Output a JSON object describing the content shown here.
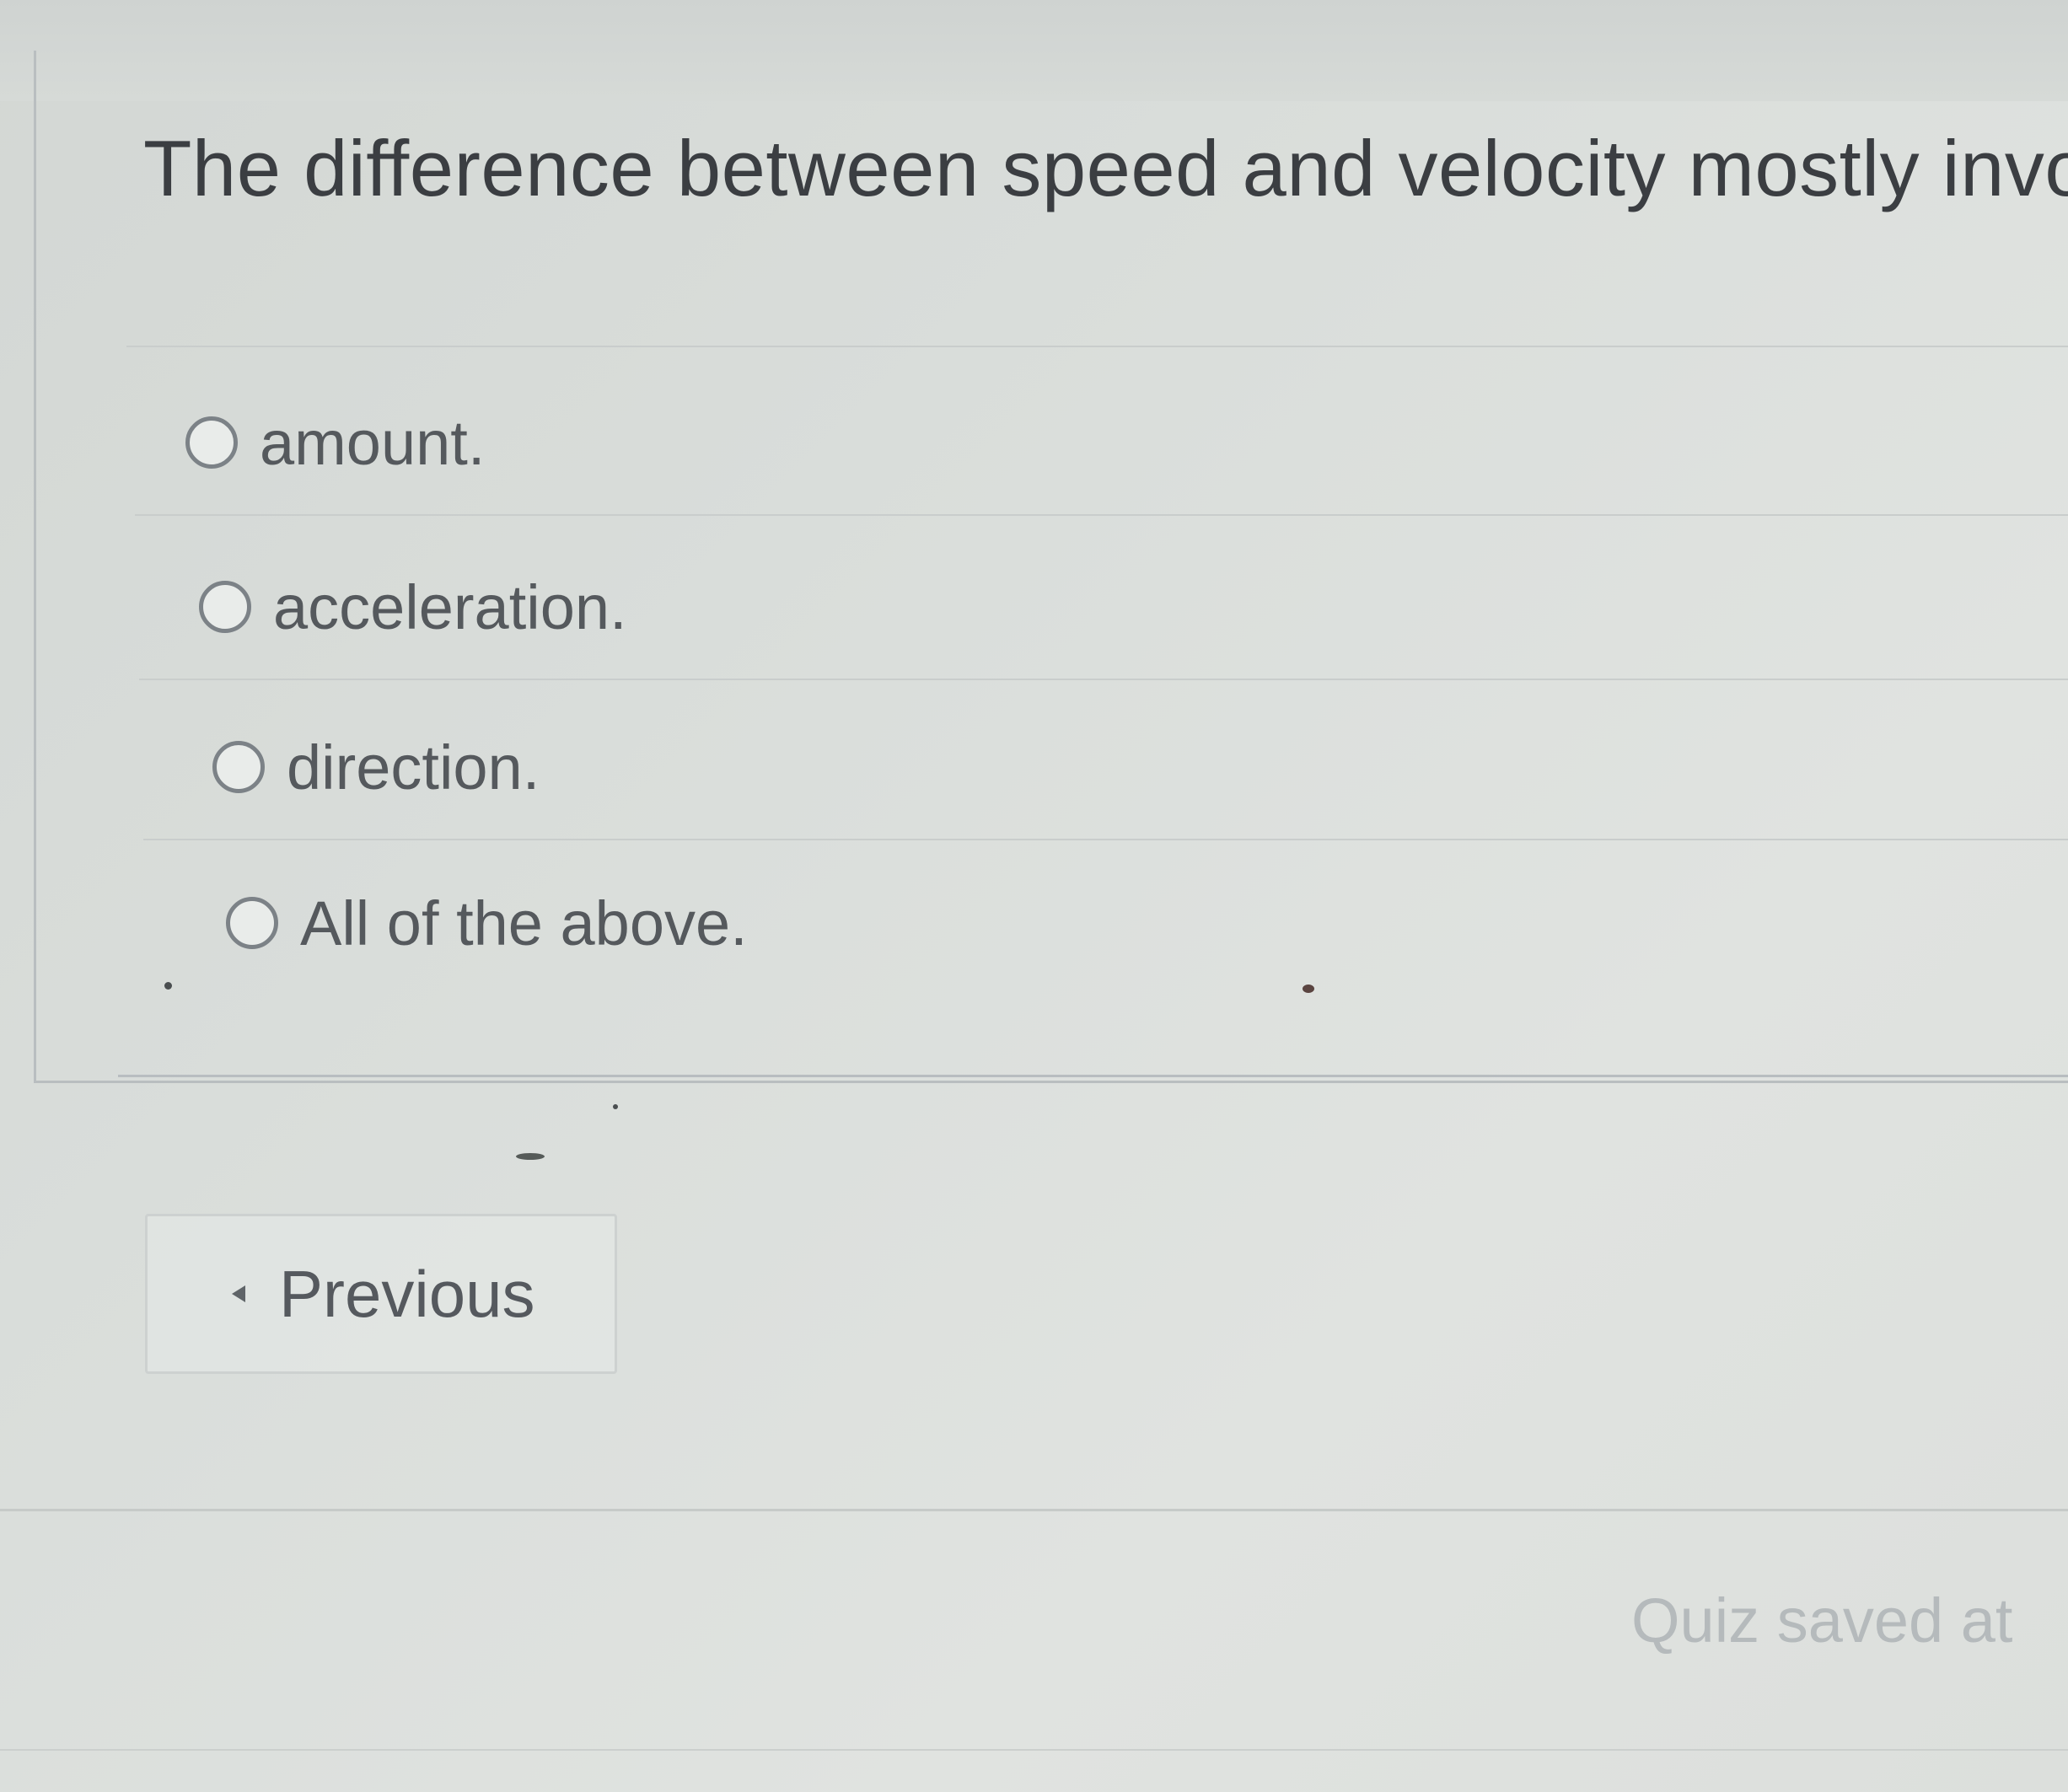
{
  "question": {
    "text": "The difference between speed and velocity mostly involve"
  },
  "options": [
    {
      "label": "amount.",
      "selected": false
    },
    {
      "label": "acceleration.",
      "selected": false
    },
    {
      "label": "direction.",
      "selected": false
    },
    {
      "label": "All of the above.",
      "selected": false
    }
  ],
  "navigation": {
    "previous_label": "Previous"
  },
  "footer": {
    "status_text": "Quiz saved at"
  },
  "colors": {
    "text": "#3b3e42",
    "muted_text": "#b5babc",
    "radio_border": "#7c8287"
  }
}
